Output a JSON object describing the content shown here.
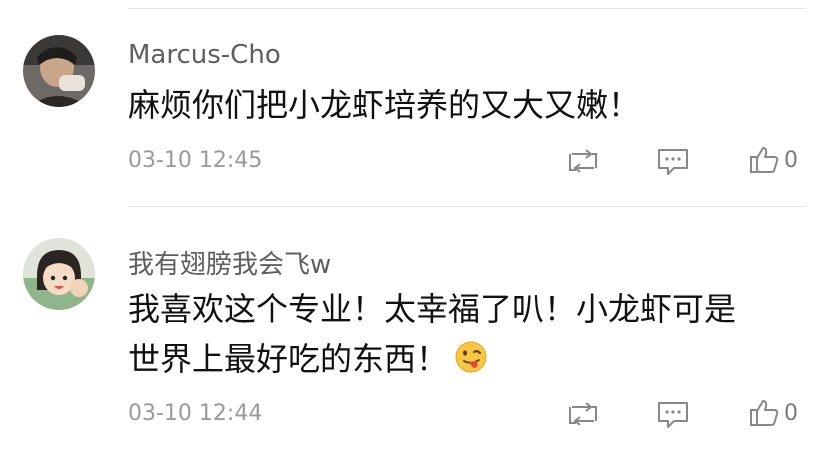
{
  "comments": [
    {
      "username": "Marcus-Cho",
      "text_lines": [
        "麻烦你们把小龙虾培养的又大又嫩！"
      ],
      "time": "03-10 12:45",
      "likes": "0"
    },
    {
      "username": "我有翅膀我会飞w",
      "text_lines": [
        "我喜欢这个专业！太幸福了叭！小龙虾可是",
        "世界上最好吃的东西！"
      ],
      "time": "03-10 12:44",
      "likes": "0"
    }
  ],
  "icons": {
    "forward": "forward-icon",
    "reply": "comment-icon",
    "like": "thumbs-up-icon",
    "emoji": "tongue-emoji-icon"
  },
  "colors": {
    "username": "#5f5f5f",
    "text": "#111111",
    "timestamp": "#9a9a9a",
    "icon": "#888888",
    "divider": "#e6e6e6"
  }
}
